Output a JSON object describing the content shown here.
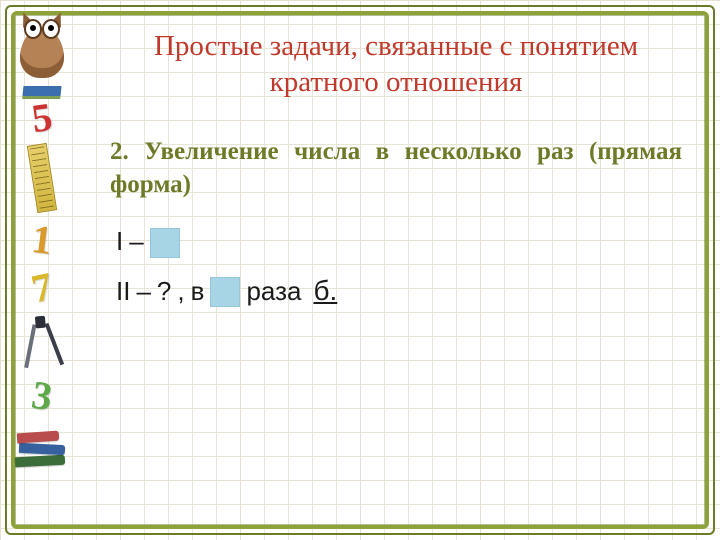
{
  "title": "Простые задачи, связанные с понятием кратного отношения",
  "subtitle": "2. Увеличение числа в несколько раз (прямая форма)",
  "line1": {
    "label": "I",
    "dash": "–"
  },
  "line2": {
    "label": "II",
    "dash": "–",
    "question": "?",
    "comma": ",",
    "in_word": "в",
    "times_word": "раза",
    "suffix": "б."
  },
  "sidebar": {
    "digits": [
      "5",
      "1",
      "7",
      "3"
    ]
  }
}
